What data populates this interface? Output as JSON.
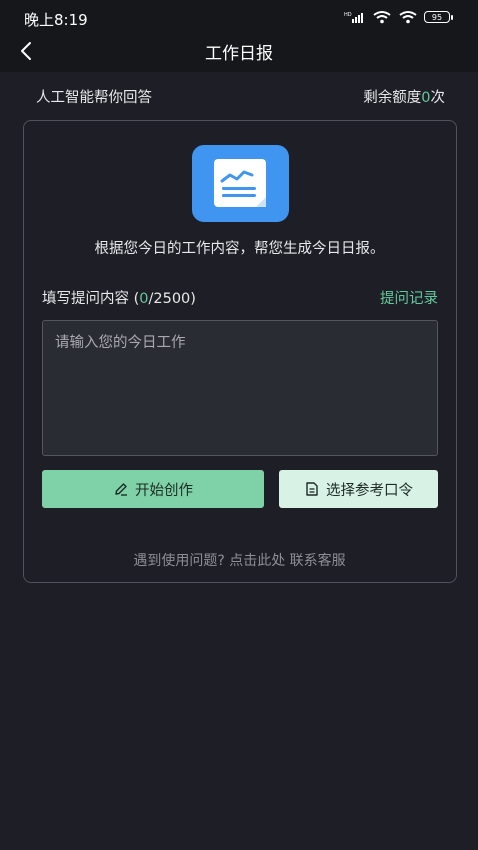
{
  "status_bar": {
    "time": "晚上8:19",
    "battery": "95"
  },
  "nav": {
    "title": "工作日报"
  },
  "subheader": {
    "left": "人工智能帮你回答",
    "quota_prefix": "剩余额度",
    "quota_count": "0",
    "quota_suffix": "次"
  },
  "card": {
    "description": "根据您今日的工作内容，帮您生成今日日报。",
    "input_label_prefix": "填写提问内容 (",
    "input_count": "0",
    "input_label_suffix": "/2500)",
    "history_link": "提问记录",
    "placeholder": "请输入您的今日工作",
    "start_button": "开始创作",
    "select_button": "选择参考口令",
    "footer_text": "遇到使用问题? 点击此处 联系客服"
  },
  "colors": {
    "accent": "#62c99a",
    "icon_bg": "#3f95f0",
    "background": "#1d1e26"
  },
  "icons": [
    "back-arrow-icon",
    "signal-icon",
    "wifi-icon",
    "battery-icon",
    "report-chart-icon",
    "pencil-icon",
    "document-icon"
  ]
}
